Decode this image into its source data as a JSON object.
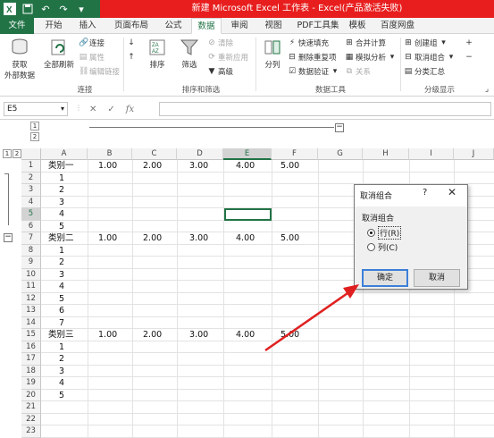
{
  "window": {
    "title": "新建 Microsoft Excel 工作表 - Excel(产品激活失败)"
  },
  "tabs": [
    "文件",
    "开始",
    "插入",
    "页面布局",
    "公式",
    "数据",
    "审阅",
    "视图",
    "PDF工具集",
    "模板",
    "百度网盘"
  ],
  "active_tab": "数据",
  "ribbon": {
    "get_external": "获取\n外部数据",
    "refresh_all": "全部刷新",
    "connections": "连接",
    "properties": "属性",
    "edit_links": "编辑链接",
    "group_connections": "连接",
    "sort": "排序",
    "filter": "筛选",
    "clear": "清除",
    "reapply": "重新应用",
    "advanced": "高级",
    "group_sort_filter": "排序和筛选",
    "split": "分列",
    "flash_fill": "快速填充",
    "remove_duplicates": "删除重复项",
    "data_validation": "数据验证",
    "consolidate": "合并计算",
    "whatif": "模拟分析",
    "relationships": "关系",
    "group_data_tools": "数据工具",
    "create_group": "创建组",
    "ungroup": "取消组合",
    "subtotal": "分类汇总",
    "group_outline": "分级显示"
  },
  "formula_bar": {
    "name_box": "E5",
    "fx": "fx",
    "content": ""
  },
  "outline": {
    "col_levels": [
      "1",
      "2"
    ],
    "row_levels": [
      "1",
      "2"
    ]
  },
  "columns": [
    "A",
    "B",
    "C",
    "D",
    "E",
    "F",
    "G",
    "H",
    "I",
    "J"
  ],
  "selected_column": "E",
  "selected_row": "5",
  "rows": [
    {
      "n": "1",
      "a": "类别一",
      "b": "1.00",
      "c": "2.00",
      "d": "3.00",
      "e": "4.00",
      "f": "5.00"
    },
    {
      "n": "2",
      "a": "1"
    },
    {
      "n": "3",
      "a": "2"
    },
    {
      "n": "4",
      "a": "3"
    },
    {
      "n": "5",
      "a": "4"
    },
    {
      "n": "6",
      "a": "5"
    },
    {
      "n": "7",
      "a": "类别二",
      "b": "1.00",
      "c": "2.00",
      "d": "3.00",
      "e": "4.00",
      "f": "5.00"
    },
    {
      "n": "8",
      "a": "1"
    },
    {
      "n": "9",
      "a": "2"
    },
    {
      "n": "10",
      "a": "3"
    },
    {
      "n": "11",
      "a": "4"
    },
    {
      "n": "12",
      "a": "5"
    },
    {
      "n": "13",
      "a": "6"
    },
    {
      "n": "14",
      "a": "7"
    },
    {
      "n": "15",
      "a": "类别三",
      "b": "1.00",
      "c": "2.00",
      "d": "3.00",
      "e": "4.00",
      "f": "5.00"
    },
    {
      "n": "16",
      "a": "1"
    },
    {
      "n": "17",
      "a": "2"
    },
    {
      "n": "18",
      "a": "3"
    },
    {
      "n": "19",
      "a": "4"
    },
    {
      "n": "20",
      "a": "5"
    },
    {
      "n": "21"
    },
    {
      "n": "22"
    },
    {
      "n": "23"
    }
  ],
  "dialog": {
    "title": "取消组合",
    "help": "?",
    "close": "✕",
    "group_label": "取消组合",
    "option_row": "行(R)",
    "option_col": "列(C)",
    "selected": "row",
    "ok": "确定",
    "cancel": "取消"
  },
  "colors": {
    "excel_green": "#217346",
    "title_red": "#e81e1e",
    "arrow_red": "#e02020",
    "dialog_default_border": "#3c7fd8"
  }
}
